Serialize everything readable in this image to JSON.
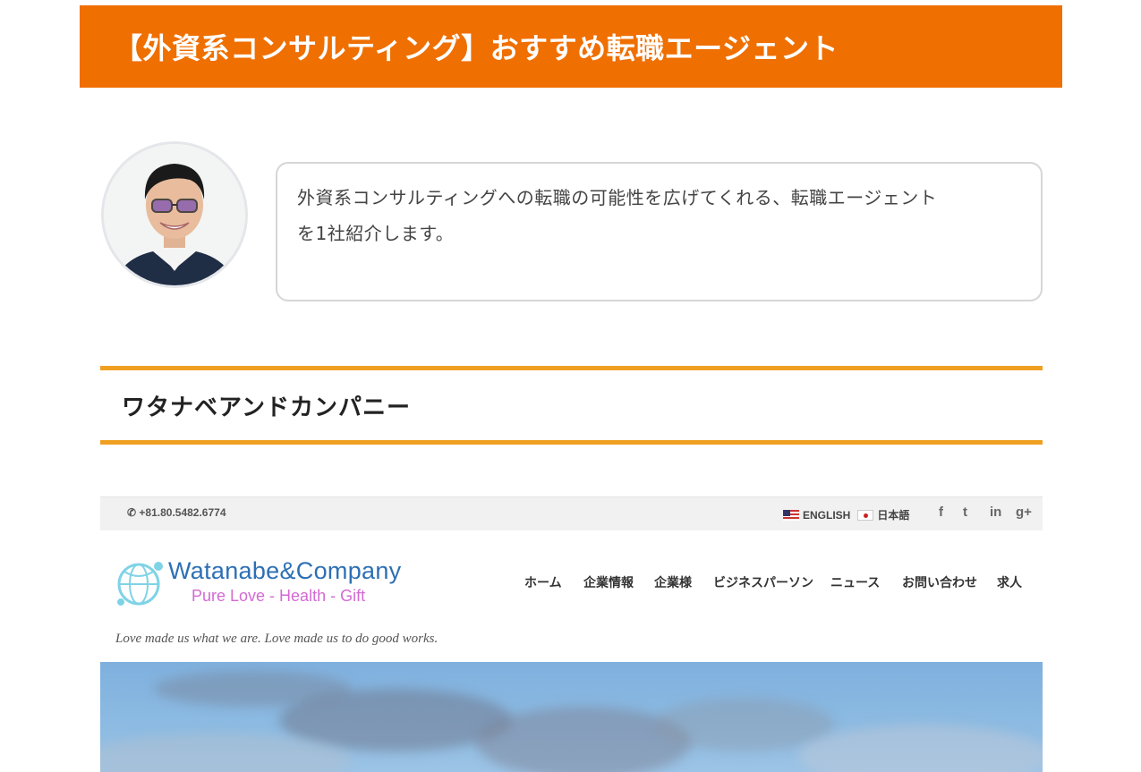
{
  "banner": {
    "title": "【外資系コンサルティング】おすすめ転職エージェント"
  },
  "speech": {
    "avatar_icon": "person-avatar",
    "line1": "外資系コンサルティングへの転職の可能性を広げてくれる、転職エージェント",
    "line2": "を1社紹介します。"
  },
  "section": {
    "heading": "ワタナベアンドカンパニー"
  },
  "screenshot": {
    "phone": "+81.80.5482.6774",
    "lang_english": "ENGLISH",
    "lang_japanese": "日本語",
    "social": [
      "f",
      "t",
      "in",
      "g+"
    ],
    "logo_name": "Watanabe&Company",
    "logo_tagline": "Pure Love - Health - Gift",
    "nav": [
      "ホーム",
      "企業情報",
      "企業様",
      "ビジネスパーソン",
      "ニュース",
      "お問い合わせ",
      "求人"
    ],
    "motto": "Love made us what we are. Love made us to do good works."
  },
  "colors": {
    "banner": "#ef6f00",
    "section_rule": "#f0a020",
    "logo_blue": "#2d6fb4",
    "logo_pink": "#d36ad3"
  }
}
